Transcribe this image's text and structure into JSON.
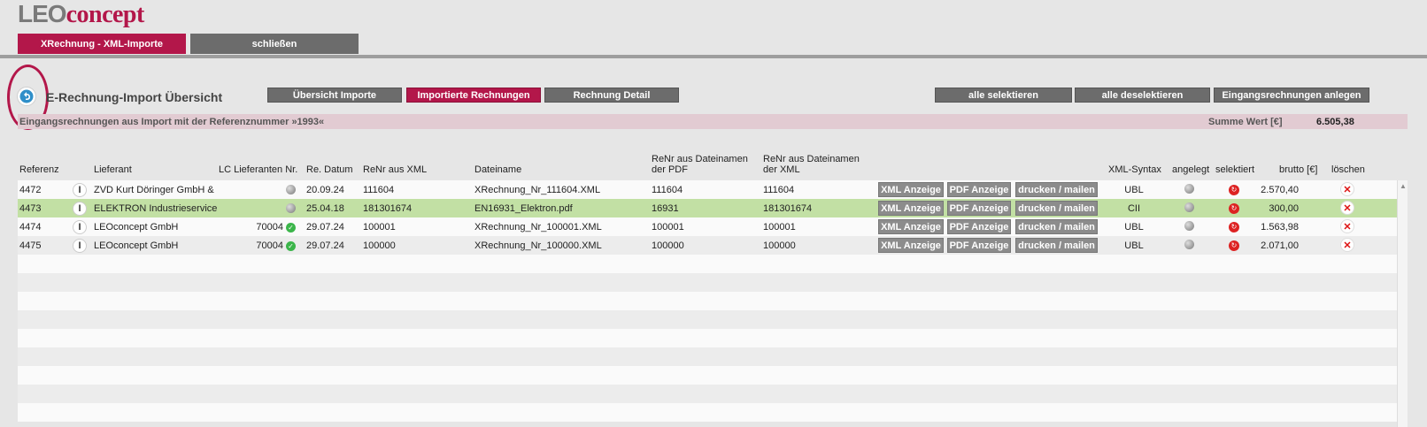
{
  "logo": {
    "part1": "LEO",
    "part2": "concept"
  },
  "topnav": {
    "active_tab": "XRechnung - XML-Importe",
    "close_tab": "schließen"
  },
  "page": {
    "title": "E-Rechnung-Import Übersicht",
    "view_buttons": [
      "Übersicht Importe",
      "Importierte Rechnungen",
      "Rechnung Detail"
    ],
    "action_buttons": [
      "alle selektieren",
      "alle deselektieren",
      "Eingangsrechnungen anlegen"
    ]
  },
  "infobar": {
    "description": "Eingangsrechnungen aus Import mit der Referenznummer »1993«",
    "sum_label": "Summe Wert [€]",
    "sum_value": "6.505,38"
  },
  "table": {
    "headers": {
      "ref": "Referenz",
      "supplier": "Lieferant",
      "lc_supplier_nr": "LC Lieferanten Nr.",
      "date": "Re. Datum",
      "renr_xml": "ReNr aus XML",
      "filename": "Dateiname",
      "renr_pdf_line1": "ReNr aus Dateinamen",
      "renr_pdf_line2": "der PDF",
      "renr_fxml_line1": "ReNr aus Dateinamen",
      "renr_fxml_line2": "der XML",
      "syntax": "XML-Syntax",
      "created": "angelegt",
      "selected": "selektiert",
      "gross": "brutto [€]",
      "delete": "löschen"
    },
    "row_buttons": {
      "xml": "XML Anzeige",
      "pdf": "PDF Anzeige",
      "print": "drucken / mailen"
    },
    "rows": [
      {
        "ref": "4472",
        "supplier": "ZVD Kurt Döringer GmbH &",
        "lc_nr": "",
        "lc_status": "gray",
        "date": "20.09.24",
        "renr_xml": "111604",
        "filename": "XRechnung_Nr_111604.XML",
        "renr_pdf": "111604",
        "renr_fxml": "111604",
        "syntax": "UBL",
        "gross": "2.570,40",
        "highlight": false
      },
      {
        "ref": "4473",
        "supplier": "ELEKTRON Industrieservice",
        "lc_nr": "",
        "lc_status": "gray",
        "date": "25.04.18",
        "renr_xml": "181301674",
        "filename": "EN16931_Elektron.pdf",
        "renr_pdf": "16931",
        "renr_fxml": "181301674",
        "syntax": "CII",
        "gross": "300,00",
        "highlight": true
      },
      {
        "ref": "4474",
        "supplier": "LEOconcept GmbH",
        "lc_nr": "70004",
        "lc_status": "green",
        "date": "29.07.24",
        "renr_xml": "100001",
        "filename": "XRechnung_Nr_100001.XML",
        "renr_pdf": "100001",
        "renr_fxml": "100001",
        "syntax": "UBL",
        "gross": "1.563,98",
        "highlight": false
      },
      {
        "ref": "4475",
        "supplier": "LEOconcept GmbH",
        "lc_nr": "70004",
        "lc_status": "green",
        "date": "29.07.24",
        "renr_xml": "100000",
        "filename": "XRechnung_Nr_100000.XML",
        "renr_pdf": "100000",
        "renr_fxml": "100000",
        "syntax": "UBL",
        "gross": "2.071,00",
        "highlight": false
      }
    ],
    "empty_rows": 9
  },
  "colors": {
    "brand": "#b3174a",
    "gray_button": "#6c6c6c",
    "highlight_row": "#c2e0a4",
    "info_bar": "#e2cbd2"
  },
  "icons": {
    "back": "back-arrow-icon",
    "cursor": "text-cursor-icon",
    "status_gray": "gray-dot-icon",
    "status_green": "green-check-icon",
    "selected": "red-refresh-icon",
    "delete": "red-x-icon"
  }
}
